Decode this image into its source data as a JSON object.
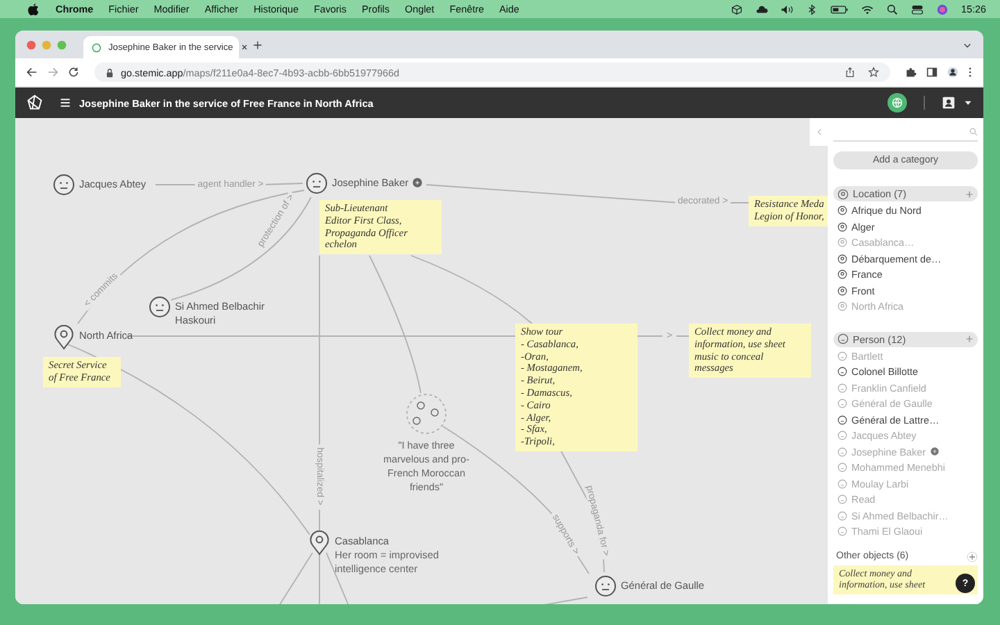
{
  "menu_bar": {
    "app": "Chrome",
    "items": [
      "Fichier",
      "Modifier",
      "Afficher",
      "Historique",
      "Favoris",
      "Profils",
      "Onglet",
      "Fenêtre",
      "Aide"
    ],
    "clock": "15:26"
  },
  "browser": {
    "tab_title": "Josephine Baker in the service",
    "url_host": "go.stemic.app",
    "url_path": "/maps/f211e0a4-8ec7-4b93-acbb-6bb51977966d"
  },
  "app_header": {
    "title": "Josephine Baker in the service of Free France in North Africa"
  },
  "map": {
    "nodes": [
      {
        "kind": "person",
        "label": "Jacques Abtey",
        "badge": false
      },
      {
        "kind": "person",
        "label": "Josephine Baker",
        "badge": true
      },
      {
        "kind": "person",
        "label": "Si Ahmed Belbachir Haskouri",
        "badge": false
      },
      {
        "kind": "location",
        "label": "North Africa",
        "badge": false
      },
      {
        "kind": "group",
        "label": "\"I have three marvelous and pro-French Moroccan friends\"",
        "badge": false
      },
      {
        "kind": "location",
        "label": "Casablanca",
        "note": "Her room = improvised intelligence center",
        "badge": false
      },
      {
        "kind": "person",
        "label": "Général de Gaulle",
        "badge": false
      }
    ],
    "notes": [
      {
        "text": "Sub-Lieutenant\nEditor First Class,\nPropaganda Officer\nechelon"
      },
      {
        "text": "Secret Service\nof Free France"
      },
      {
        "text": "Resistance Meda\nLegion of Honor,"
      },
      {
        "text": "Show tour\n- Casablanca,\n-Oran,\n- Mostaganem,\n- Beirut,\n- Damascus,\n- Cairo\n- Alger,\n- Sfax,\n-Tripoli,"
      },
      {
        "text": "Collect money and\ninformation, use sheet\nmusic to conceal\nmessages"
      }
    ],
    "edge_labels": [
      "agent handler >",
      "< commits",
      "protection of >",
      "decorated >",
      "hospitalized >",
      "supports >",
      "propaganda for >",
      ">"
    ]
  },
  "sidebar": {
    "add_button": "Add a category",
    "categories": [
      {
        "kind": "location",
        "name": "Location (7)",
        "items": [
          {
            "label": "Afrique du Nord",
            "dimmed": false,
            "badge": false
          },
          {
            "label": "Alger",
            "dimmed": false,
            "badge": false
          },
          {
            "label": "Casablanca…",
            "dimmed": true,
            "badge": false
          },
          {
            "label": "Débarquement de…",
            "dimmed": false,
            "badge": false
          },
          {
            "label": "France",
            "dimmed": false,
            "badge": false
          },
          {
            "label": "Front",
            "dimmed": false,
            "badge": false
          },
          {
            "label": "North Africa",
            "dimmed": true,
            "badge": false
          }
        ]
      },
      {
        "kind": "person",
        "name": "Person (12)",
        "items": [
          {
            "label": "Bartlett",
            "dimmed": true,
            "badge": false
          },
          {
            "label": "Colonel Billotte",
            "dimmed": false,
            "badge": false
          },
          {
            "label": "Franklin Canfield",
            "dimmed": true,
            "badge": false
          },
          {
            "label": "Général de Gaulle",
            "dimmed": true,
            "badge": false
          },
          {
            "label": "Général de Lattre…",
            "dimmed": false,
            "badge": false
          },
          {
            "label": "Jacques Abtey",
            "dimmed": true,
            "badge": false
          },
          {
            "label": "Josephine Baker",
            "dimmed": true,
            "badge": true
          },
          {
            "label": "Mohammed Menebhi",
            "dimmed": true,
            "badge": false
          },
          {
            "label": "Moulay Larbi",
            "dimmed": true,
            "badge": false
          },
          {
            "label": "Read",
            "dimmed": true,
            "badge": false
          },
          {
            "label": "Si Ahmed Belbachir…",
            "dimmed": true,
            "badge": false
          },
          {
            "label": "Thami El Glaoui",
            "dimmed": true,
            "badge": false
          }
        ]
      }
    ],
    "other_objects": {
      "label": "Other objects (6)",
      "note_preview": "Collect money and\ninformation, use sheet"
    },
    "help": "?"
  }
}
